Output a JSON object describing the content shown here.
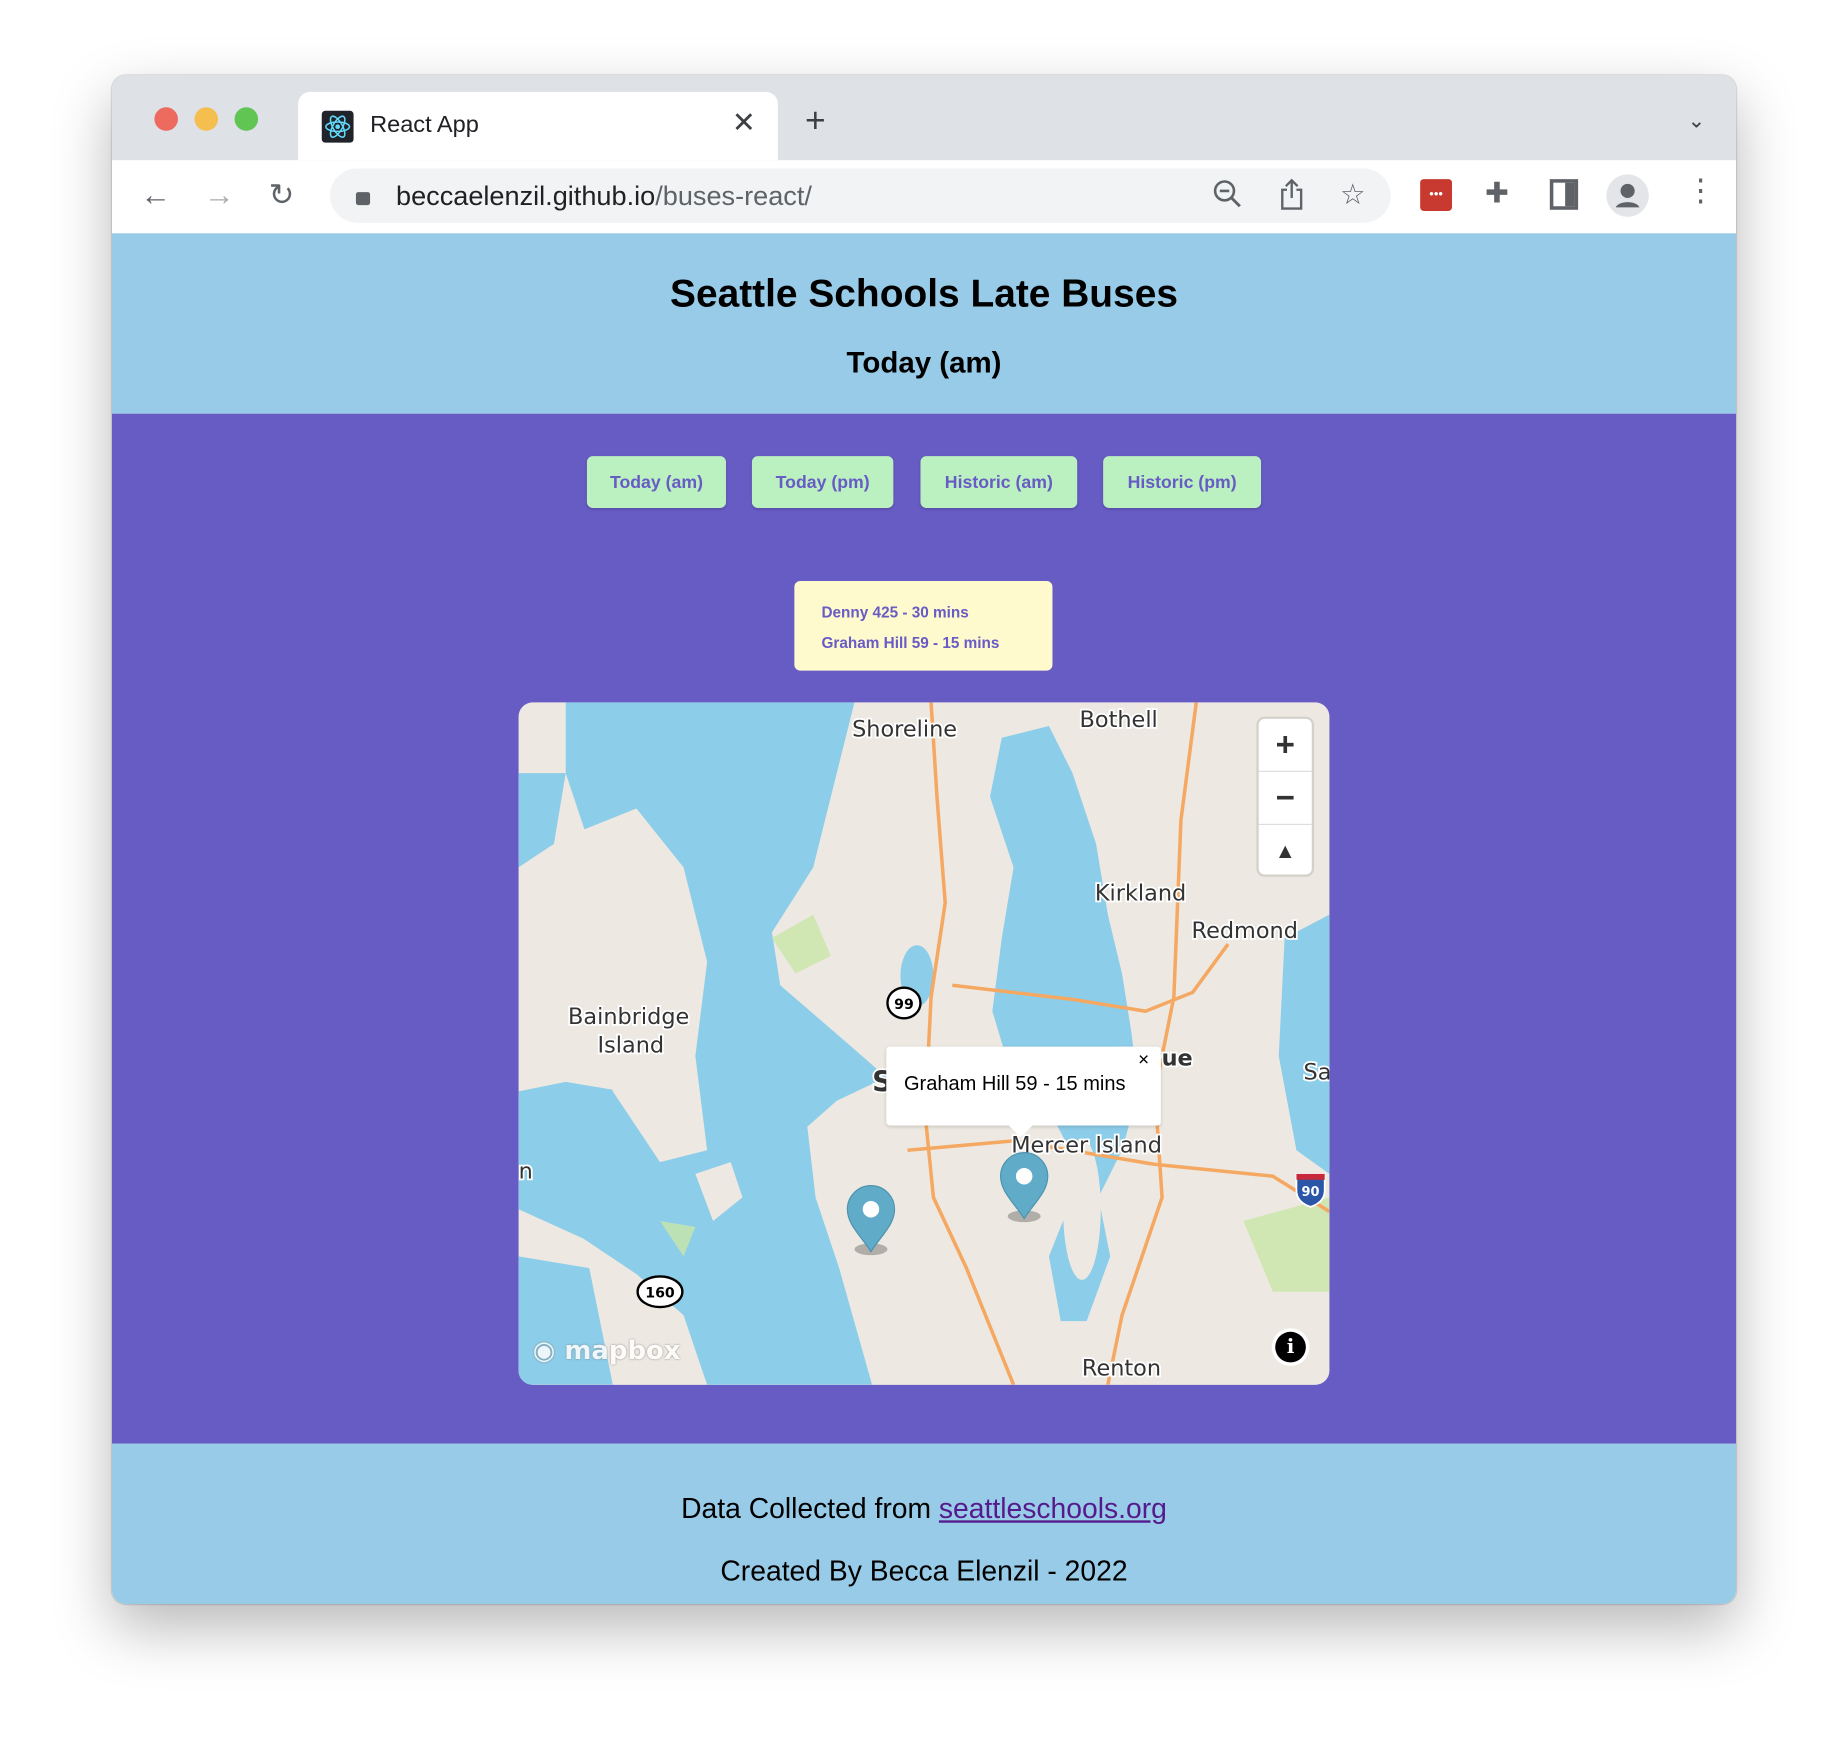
{
  "browser": {
    "tab_title": "React App",
    "url_host": "beccaelenzil.github.io",
    "url_path": "/buses-react/"
  },
  "header": {
    "title": "Seattle Schools Late Buses",
    "subtitle": "Today (am)"
  },
  "buttons": [
    {
      "label": "Today (am)"
    },
    {
      "label": "Today (pm)"
    },
    {
      "label": "Historic (am)"
    },
    {
      "label": "Historic (pm)"
    }
  ],
  "late_buses": [
    "Denny 425 - 30 mins",
    "Graham Hill 59 - 15 mins"
  ],
  "map": {
    "labels": {
      "shoreline": "Shoreline",
      "bothell": "Bothell",
      "kirkland": "Kirkland",
      "redmond": "Redmond",
      "bainbridge1": "Bainbridge",
      "bainbridge2": "Island",
      "bellevue": "Bellevue",
      "seattle": "S",
      "sammamish": "Sa",
      "mercer": "Mercer Island",
      "renton": "Renton",
      "left_n": "n"
    },
    "shields": {
      "sr99": "99",
      "sr160": "160",
      "i90": "90"
    },
    "popup_text": "Graham Hill 59 - 15 mins",
    "popup_close": "×",
    "zoom_in": "+",
    "zoom_out": "−",
    "compass": "▲",
    "info": "i",
    "attribution_logo": "mapbox",
    "marker_color": "#5fabc8"
  },
  "footer": {
    "data_prefix": "Data Collected from ",
    "data_link": "seattleschools.org",
    "credit": "Created By Becca Elenzil - 2022"
  },
  "colors": {
    "header_bg": "#97cbe8",
    "main_bg": "#675bc4",
    "button_bg": "#bbf0c1",
    "notice_bg": "#fff9ce"
  }
}
